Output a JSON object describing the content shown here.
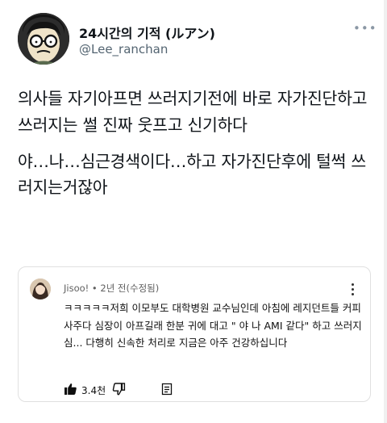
{
  "tweet": {
    "display_name": "24시간의 기적 (ルアン)",
    "handle": "@Lee_ranchan",
    "more_icon": "more-horizontal-icon",
    "paragraphs": [
      "의사들 자기아프면 쓰러지기전에 바로 자가진단하고 쓰러지는 썰 진짜 웃프고 신기하다",
      "야…나…심근경색이다…하고 자가진단후에 털썩 쓰러지는거잖아"
    ]
  },
  "comment": {
    "author": "Jisoo!",
    "time": "2년 전(수정됨)",
    "text": "ㅋㅋㅋㅋㅋ저희 이모부도 대학병원 교수님인데  아침에 레지던트들 커피 사주다 심장이 아프길래 한분 귀에 대고 \" 야 나 AMI 같다\" 하고 쓰러지심... 다행히 신속한 처리로 지금은 아주 건강하십니다",
    "like_count": "3.4천",
    "icons": [
      "thumbs-up-icon",
      "thumbs-down-icon",
      "reply-icon",
      "more-vertical-icon"
    ]
  }
}
